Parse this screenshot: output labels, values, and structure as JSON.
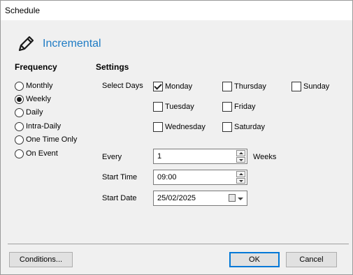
{
  "window": {
    "title": "Schedule"
  },
  "header": {
    "title": "Incremental",
    "icon": "pencil-icon",
    "title_color": "#1e7bc4"
  },
  "frequency": {
    "label": "Frequency",
    "selected": "Weekly",
    "options": [
      "Monthly",
      "Weekly",
      "Daily",
      "Intra-Daily",
      "One Time Only",
      "On Event"
    ]
  },
  "settings": {
    "label": "Settings",
    "select_days_label": "Select Days",
    "days": [
      {
        "label": "Monday",
        "checked": true
      },
      {
        "label": "Thursday",
        "checked": false
      },
      {
        "label": "Sunday",
        "checked": false
      },
      {
        "label": "Tuesday",
        "checked": false
      },
      {
        "label": "Friday",
        "checked": false
      },
      {
        "label": "Wednesday",
        "checked": false
      },
      {
        "label": "Saturday",
        "checked": false
      }
    ],
    "every_label": "Every",
    "every_value": "1",
    "every_unit": "Weeks",
    "start_time_label": "Start Time",
    "start_time_value": "09:00",
    "start_date_label": "Start Date",
    "start_date_value": "25/02/2025"
  },
  "buttons": {
    "conditions": "Conditions...",
    "ok": "OK",
    "cancel": "Cancel"
  }
}
